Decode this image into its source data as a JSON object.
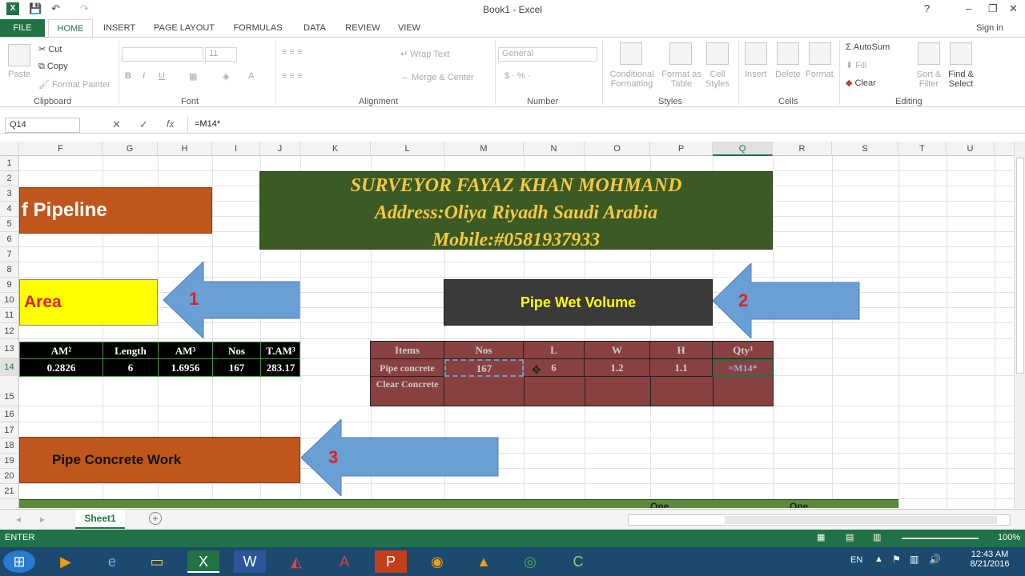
{
  "window": {
    "title": "Book1 - Excel",
    "sign_in": "Sign in"
  },
  "tabs": [
    "FILE",
    "HOME",
    "INSERT",
    "PAGE LAYOUT",
    "FORMULAS",
    "DATA",
    "REVIEW",
    "VIEW"
  ],
  "ribbon": {
    "clipboard": {
      "paste": "Paste",
      "cut": "Cut",
      "copy": "Copy",
      "format_painter": "Format Painter",
      "label": "Clipboard"
    },
    "font": {
      "size": "11",
      "label": "Font"
    },
    "alignment": {
      "wrap": "Wrap Text",
      "merge": "Merge & Center",
      "label": "Alignment"
    },
    "number": {
      "format": "General",
      "label": "Number"
    },
    "styles": {
      "cond": "Conditional Formatting",
      "format_table": "Format as Table",
      "cell_styles": "Cell Styles",
      "label": "Styles"
    },
    "cells": {
      "insert": "Insert",
      "delete": "Delete",
      "format": "Format",
      "label": "Cells"
    },
    "editing": {
      "autosum": "AutoSum",
      "fill": "Fill",
      "clear": "Clear",
      "sort": "Sort & Filter",
      "find": "Find & Select",
      "label": "Editing"
    }
  },
  "formula_bar": {
    "name_box": "Q14",
    "formula": "=M14*"
  },
  "columns": [
    "F",
    "G",
    "H",
    "I",
    "J",
    "K",
    "L",
    "M",
    "N",
    "O",
    "P",
    "Q",
    "R",
    "S",
    "T",
    "U"
  ],
  "rows": [
    "1",
    "2",
    "3",
    "4",
    "5",
    "6",
    "7",
    "8",
    "9",
    "10",
    "11",
    "12",
    "13",
    "14",
    "15",
    "16",
    "17",
    "18",
    "19",
    "20",
    "21"
  ],
  "banner": {
    "line1": "SURVEYOR FAYAZ KHAN MOHMAND",
    "line2": "Address:Oliya Riyadh Saudi Arabia",
    "line3": "Mobile:#0581937933"
  },
  "shapes": {
    "pipeline": "f Pipeline",
    "area": "Area",
    "wet": "Pipe Wet Volume",
    "concrete": "Pipe Concrete Work"
  },
  "arrows": [
    "1",
    "2",
    "3"
  ],
  "area_table": {
    "headers": [
      "AM²",
      "Length",
      "AM³",
      "Nos",
      "T.AM³"
    ],
    "row": [
      "0.2826",
      "6",
      "1.6956",
      "167",
      "283.17"
    ]
  },
  "vol_table": {
    "headers": [
      "Items",
      "Nos",
      "L",
      "W",
      "H",
      "Qty³"
    ],
    "row1": [
      "Pipe concrete",
      "167",
      "6",
      "1.2",
      "1.1",
      "=M14*"
    ],
    "row2_label": "Clear Concrete"
  },
  "row22_fragments": [
    "One",
    "One"
  ],
  "sheet_tab": "Sheet1",
  "status": {
    "mode": "ENTER",
    "zoom": "100%"
  },
  "taskbar": {
    "lang": "EN",
    "time": "12:43 AM",
    "date": "8/21/2016"
  },
  "colors": {
    "excel_green": "#217346",
    "banner_green": "#3c5a23",
    "banner_text": "#f5c842",
    "orange": "#c0561c",
    "arrow_blue": "#6a9fd6",
    "maroon": "#884040"
  }
}
